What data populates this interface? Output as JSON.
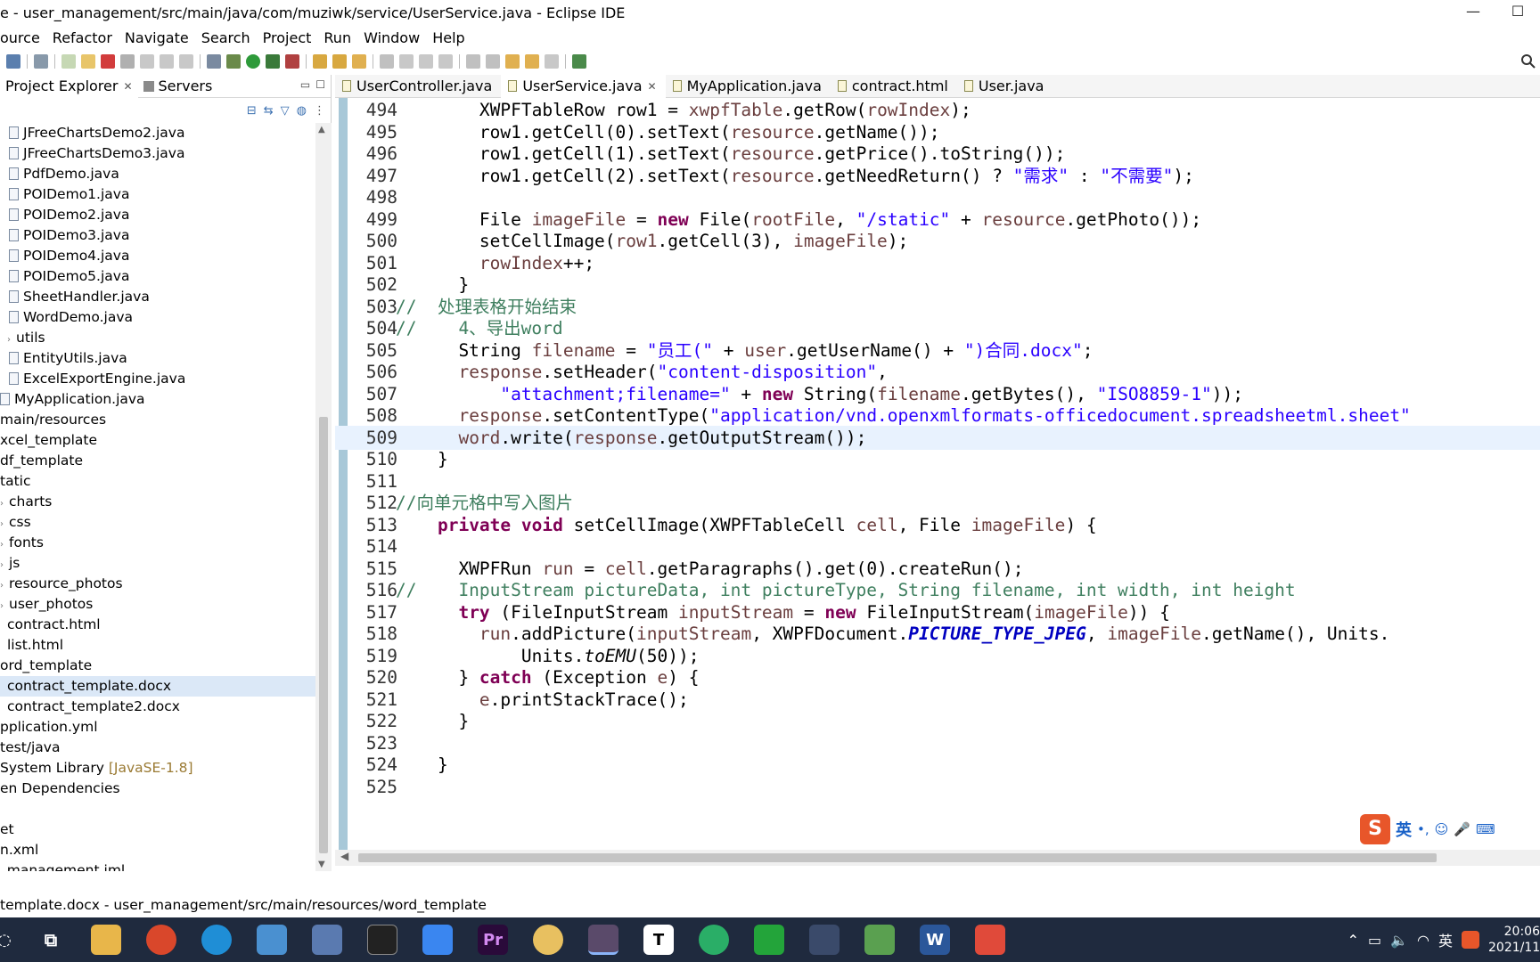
{
  "window": {
    "title": "e - user_management/src/main/java/com/muziwk/service/UserService.java - Eclipse IDE",
    "min": "—",
    "max": "☐"
  },
  "menu": [
    "ource",
    "Refactor",
    "Navigate",
    "Search",
    "Project",
    "Run",
    "Window",
    "Help"
  ],
  "left_panel": {
    "tabs": [
      {
        "label": "Project Explorer",
        "close": "✕"
      },
      {
        "label": "Servers"
      }
    ]
  },
  "tree": [
    {
      "label": "JFreeChartsDemo2.java",
      "type": "file",
      "indent": 10
    },
    {
      "label": "JFreeChartsDemo3.java",
      "type": "file",
      "indent": 10
    },
    {
      "label": "PdfDemo.java",
      "type": "file",
      "indent": 10
    },
    {
      "label": "POIDemo1.java",
      "type": "file",
      "indent": 10
    },
    {
      "label": "POIDemo2.java",
      "type": "file",
      "indent": 10
    },
    {
      "label": "POIDemo3.java",
      "type": "file",
      "indent": 10
    },
    {
      "label": "POIDemo4.java",
      "type": "file",
      "indent": 10
    },
    {
      "label": "POIDemo5.java",
      "type": "file",
      "indent": 10
    },
    {
      "label": "SheetHandler.java",
      "type": "file",
      "indent": 10
    },
    {
      "label": "WordDemo.java",
      "type": "file",
      "indent": 10
    },
    {
      "label": "utils",
      "type": "folder",
      "indent": 8
    },
    {
      "label": "EntityUtils.java",
      "type": "file",
      "indent": 10
    },
    {
      "label": "ExcelExportEngine.java",
      "type": "file",
      "indent": 10
    },
    {
      "label": "MyApplication.java",
      "type": "file",
      "indent": 0
    },
    {
      "label": "main/resources",
      "type": "plain",
      "indent": 0
    },
    {
      "label": "xcel_template",
      "type": "plain",
      "indent": 0
    },
    {
      "label": "df_template",
      "type": "plain",
      "indent": 0
    },
    {
      "label": "tatic",
      "type": "plain",
      "indent": 0
    },
    {
      "label": "charts",
      "type": "folder",
      "indent": 0
    },
    {
      "label": "css",
      "type": "folder",
      "indent": 0
    },
    {
      "label": "fonts",
      "type": "folder",
      "indent": 0
    },
    {
      "label": "js",
      "type": "folder",
      "indent": 0
    },
    {
      "label": "resource_photos",
      "type": "folder",
      "indent": 0
    },
    {
      "label": "user_photos",
      "type": "folder",
      "indent": 0
    },
    {
      "label": "contract.html",
      "type": "plain",
      "indent": 8
    },
    {
      "label": "list.html",
      "type": "plain",
      "indent": 8
    },
    {
      "label": "ord_template",
      "type": "plain",
      "indent": 0
    },
    {
      "label": "contract_template.docx",
      "type": "plain",
      "indent": 8,
      "selected": true
    },
    {
      "label": "contract_template2.docx",
      "type": "plain",
      "indent": 8
    },
    {
      "label": "pplication.yml",
      "type": "plain",
      "indent": 0
    },
    {
      "label": "test/java",
      "type": "plain",
      "indent": 0
    },
    {
      "label": "System Library ",
      "type": "plain",
      "indent": 0,
      "suffix": "[JavaSE-1.8]"
    },
    {
      "label": "en Dependencies",
      "type": "plain",
      "indent": 0
    },
    {
      "label": "",
      "type": "plain",
      "indent": 0
    },
    {
      "label": "et",
      "type": "plain",
      "indent": 0
    },
    {
      "label": "n.xml",
      "type": "plain",
      "indent": 0
    },
    {
      "label": "_management.iml",
      "type": "plain",
      "indent": 0
    }
  ],
  "editor_tabs": [
    {
      "label": "UserController.java"
    },
    {
      "label": "UserService.java",
      "active": true,
      "close": "✕"
    },
    {
      "label": "MyApplication.java"
    },
    {
      "label": "contract.html"
    },
    {
      "label": "User.java"
    }
  ],
  "code_lines": [
    {
      "n": "494",
      "html": "        XWPFTableRow row1 = <span class=\"var\">xwpfTable</span>.getRow(<span class=\"var\">rowIndex</span>);"
    },
    {
      "n": "495",
      "html": "        row1.getCell(0).setText(<span class=\"var\">resource</span>.getName());"
    },
    {
      "n": "496",
      "html": "        row1.getCell(1).setText(<span class=\"var\">resource</span>.getPrice().toString());"
    },
    {
      "n": "497",
      "html": "        row1.getCell(2).setText(<span class=\"var\">resource</span>.getNeedReturn() ? <span class=\"str\">\"需求\"</span> : <span class=\"str\">\"不需要\"</span>);"
    },
    {
      "n": "498",
      "html": ""
    },
    {
      "n": "499",
      "html": "        File <span class=\"var\">imageFile</span> = <span class=\"kw\">new</span> File(<span class=\"var\">rootFile</span>, <span class=\"str\">\"/static\"</span> + <span class=\"var\">resource</span>.getPhoto());"
    },
    {
      "n": "500",
      "html": "        setCellImage(<span class=\"var\">row1</span>.getCell(3), <span class=\"var\">imageFile</span>);"
    },
    {
      "n": "501",
      "html": "        <span class=\"var\">rowIndex</span>++;"
    },
    {
      "n": "502",
      "html": "      }"
    },
    {
      "n": "503",
      "html": "<span class=\"com\">//  处理表格开始结束</span>"
    },
    {
      "n": "504",
      "html": "<span class=\"com\">//    4、导出word</span>"
    },
    {
      "n": "505",
      "html": "      String <span class=\"var\">filename</span> = <span class=\"str\">\"员工(\"</span> + <span class=\"var\">user</span>.getUserName() + <span class=\"str\">\")合同.docx\"</span>;"
    },
    {
      "n": "506",
      "html": "      <span class=\"var\">response</span>.setHeader(<span class=\"str\">\"content-disposition\"</span>,"
    },
    {
      "n": "507",
      "html": "          <span class=\"str\">\"attachment;filename=\"</span> + <span class=\"kw\">new</span> String(<span class=\"var\">filename</span>.getBytes(), <span class=\"str\">\"ISO8859-1\"</span>));"
    },
    {
      "n": "508",
      "html": "      <span class=\"var\">response</span>.setContentType(<span class=\"str\">\"application/vnd.openxmlformats-officedocument.spreadsheetml.sheet\"</span>"
    },
    {
      "n": "509",
      "html": "      <span class=\"var\">word</span>.write(<span class=\"var\">response</span>.getOutputStream());",
      "current": true
    },
    {
      "n": "510",
      "html": "    }"
    },
    {
      "n": "511",
      "html": ""
    },
    {
      "n": "512",
      "html": "<span class=\"com\">//向单元格中写入图片</span>"
    },
    {
      "n": "513",
      "html": "    <span class=\"kw\">private</span> <span class=\"kw\">void</span> setCellImage(XWPFTableCell <span class=\"var\">cell</span>, File <span class=\"var\">imageFile</span>) {"
    },
    {
      "n": "514",
      "html": ""
    },
    {
      "n": "515",
      "html": "      XWPFRun <span class=\"var\">run</span> = <span class=\"var\">cell</span>.getParagraphs().get(0).createRun();"
    },
    {
      "n": "516",
      "html": "<span class=\"com\">//    InputStream pictureData, int pictureType, String filename, int width, int height</span>"
    },
    {
      "n": "517",
      "html": "      <span class=\"kw\">try</span> (FileInputStream <span class=\"var\">inputStream</span> = <span class=\"kw\">new</span> FileInputStream(<span class=\"var\">imageFile</span>)) {"
    },
    {
      "n": "518",
      "html": "        <span class=\"var\">run</span>.addPicture(<span class=\"var\">inputStream</span>, XWPFDocument.<span class=\"cst\">PICTURE_TYPE_JPEG</span>, <span class=\"var\">imageFile</span>.getName(), Units."
    },
    {
      "n": "519",
      "html": "            Units.<span class=\"sti\">toEMU</span>(50));"
    },
    {
      "n": "520",
      "html": "      } <span class=\"kw\">catch</span> (Exception <span class=\"var\">e</span>) {"
    },
    {
      "n": "521",
      "html": "        <span class=\"var\">e</span>.printStackTrace();"
    },
    {
      "n": "522",
      "html": "      }"
    },
    {
      "n": "523",
      "html": ""
    },
    {
      "n": "524",
      "html": "    }"
    },
    {
      "n": "525",
      "html": ""
    }
  ],
  "ime": {
    "logo": "S",
    "lang": "英"
  },
  "statusbar": "template.docx - user_management/src/main/resources/word_template",
  "tray": {
    "time": "20:06",
    "date": "2021/11",
    "lang": "英"
  },
  "colors": {
    "keyword": "#7f0055",
    "string": "#2a00ff",
    "comment": "#3f7f5f",
    "taskbar": "#1f2a3e"
  }
}
